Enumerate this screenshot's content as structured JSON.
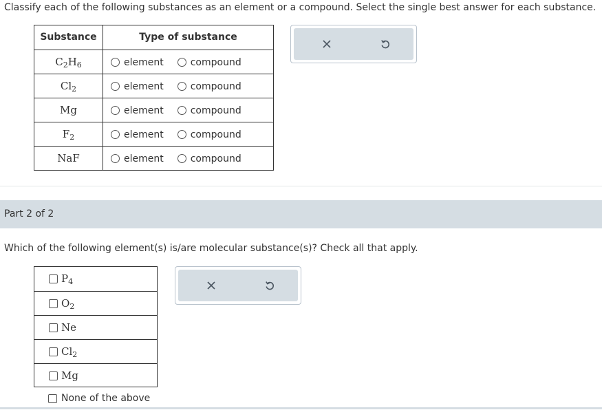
{
  "part1": {
    "instruction": "Classify each of the following substances as an element or a compound. Select the single best answer for each substance.",
    "headers": {
      "substance": "Substance",
      "type": "Type of substance"
    },
    "rows": [
      {
        "base": "C",
        "sub1": "2",
        "mid": "H",
        "sub2": "6",
        "option_a": "element",
        "option_b": "compound"
      },
      {
        "base": "Cl",
        "sub1": "2",
        "mid": "",
        "sub2": "",
        "option_a": "element",
        "option_b": "compound"
      },
      {
        "base": "Mg",
        "sub1": "",
        "mid": "",
        "sub2": "",
        "option_a": "element",
        "option_b": "compound"
      },
      {
        "base": "F",
        "sub1": "2",
        "mid": "",
        "sub2": "",
        "option_a": "element",
        "option_b": "compound"
      },
      {
        "base": "NaF",
        "sub1": "",
        "mid": "",
        "sub2": "",
        "option_a": "element",
        "option_b": "compound"
      }
    ]
  },
  "part2": {
    "header": "Part 2 of 2",
    "question": "Which of the following element(s) is/are molecular substance(s)? Check all that apply.",
    "choices": [
      {
        "base": "P",
        "sub": "4"
      },
      {
        "base": "O",
        "sub": "2"
      },
      {
        "base": "Ne",
        "sub": ""
      },
      {
        "base": "Cl",
        "sub": "2"
      },
      {
        "base": "Mg",
        "sub": ""
      }
    ],
    "none_label": "None of the above"
  },
  "icons": {
    "clear": "x-icon",
    "undo": "undo-icon"
  },
  "colors": {
    "panel": "#d5dde3",
    "text": "#333333",
    "border": "#333333"
  }
}
